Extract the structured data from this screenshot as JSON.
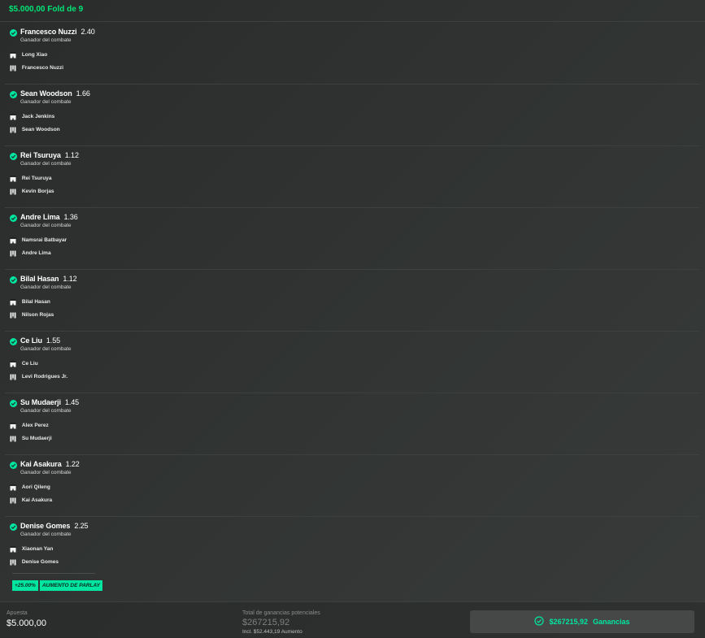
{
  "header": {
    "title": "$5.000,00 Fold de 9"
  },
  "legs": [
    {
      "selection": "Francesco Nuzzi",
      "odds": "2.40",
      "market": "Ganador del combate",
      "team1": "Long Xiao",
      "team2": "Francesco Nuzzi"
    },
    {
      "selection": "Sean Woodson",
      "odds": "1.66",
      "market": "Ganador del combate",
      "team1": "Jack Jenkins",
      "team2": "Sean Woodson"
    },
    {
      "selection": "Rei Tsuruya",
      "odds": "1.12",
      "market": "Ganador del combate",
      "team1": "Rei Tsuruya",
      "team2": "Kevin Borjas"
    },
    {
      "selection": "Andre Lima",
      "odds": "1.36",
      "market": "Ganador del combate",
      "team1": "Namsrai Batbayar",
      "team2": "Andre Lima"
    },
    {
      "selection": "Bilal Hasan",
      "odds": "1.12",
      "market": "Ganador del combate",
      "team1": "Bilal Hasan",
      "team2": "Nilson Rojas"
    },
    {
      "selection": "Ce Liu",
      "odds": "1.55",
      "market": "Ganador del combate",
      "team1": "Ce Liu",
      "team2": "Levi Rodrigues Jr."
    },
    {
      "selection": "Su Mudaerji",
      "odds": "1.45",
      "market": "Ganador del combate",
      "team1": "Alex Perez",
      "team2": "Su Mudaerji"
    },
    {
      "selection": "Kai Asakura",
      "odds": "1.22",
      "market": "Ganador del combate",
      "team1": "Aori Qileng",
      "team2": "Kai Asakura"
    },
    {
      "selection": "Denise Gomes",
      "odds": "2.25",
      "market": "Ganador del combate",
      "team1": "Xiaonan Yan",
      "team2": "Denise Gomes"
    }
  ],
  "boost": {
    "percent": "+25.00%",
    "label": "AUMENTO DE PARLAY"
  },
  "footer": {
    "stake_label": "Apuesta",
    "stake_value": "$5.000,00",
    "potential_label": "Total de ganancias potenciales",
    "potential_value": "$267215,92",
    "potential_incl": "Incl. $52.443,19 Aumento",
    "win_amount": "$267215,92",
    "win_label": "Ganancias"
  },
  "colors": {
    "accent": "#00e6a0",
    "header_accent": "#00e676"
  },
  "icons": {
    "check": "check-circle-icon",
    "team1": "fighter-shorts-icon",
    "team2": "fighter-shorts-striped-icon",
    "win": "check-circle-outline-icon"
  }
}
